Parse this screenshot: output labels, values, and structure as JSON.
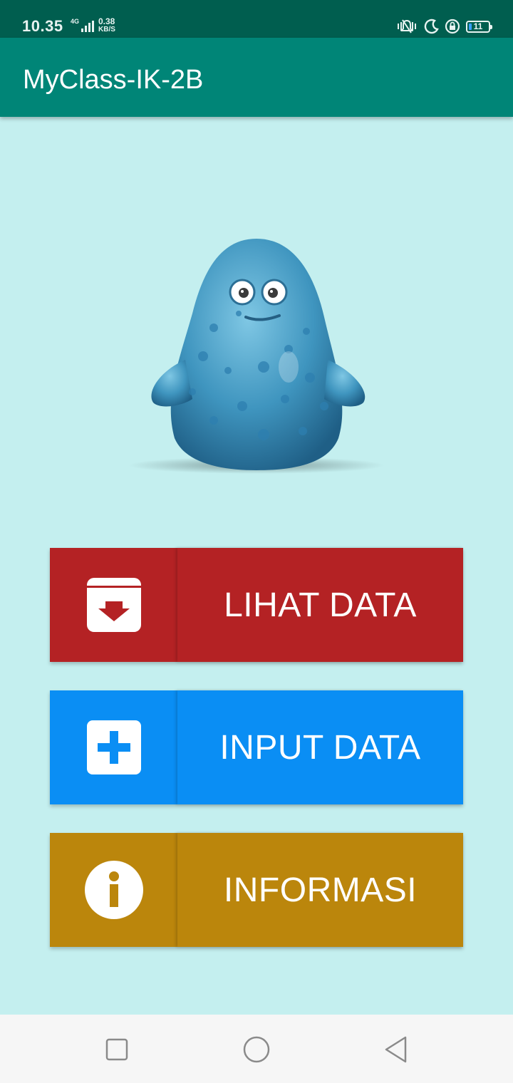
{
  "status_bar": {
    "time": "10.35",
    "network_type": "4G",
    "speed_value": "0.38",
    "speed_unit": "KB/S",
    "battery_level": "11",
    "icons": [
      "vibrate-icon",
      "moon-icon",
      "rotation-lock-icon",
      "battery-icon"
    ]
  },
  "app_bar": {
    "title": "MyClass-IK-2B"
  },
  "menu": {
    "buttons": [
      {
        "label": "LIHAT DATA",
        "icon": "archive-down-icon",
        "color": "#b42224"
      },
      {
        "label": "INPUT DATA",
        "icon": "plus-box-icon",
        "color": "#0a8ef4"
      },
      {
        "label": "INFORMASI",
        "icon": "info-icon",
        "color": "#bb860c"
      }
    ]
  },
  "nav_bar": {
    "icons": [
      "recents-square-icon",
      "home-circle-icon",
      "back-triangle-icon"
    ]
  },
  "colors": {
    "status_bar": "#005e4f",
    "app_bar": "#008577",
    "background": "#c4efef"
  }
}
